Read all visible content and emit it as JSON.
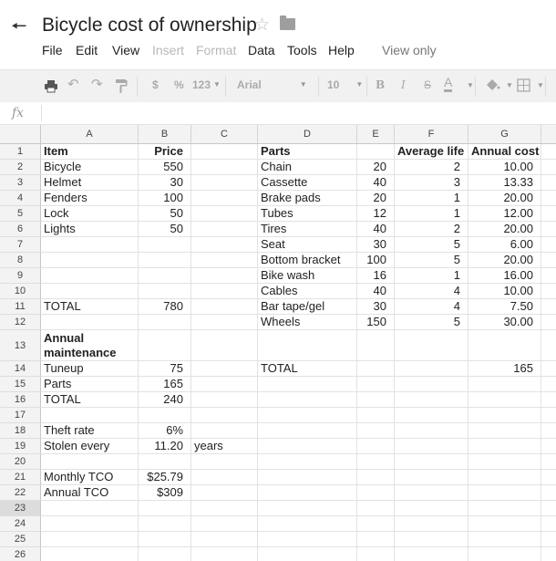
{
  "title": "Bicycle cost of ownership",
  "menu": [
    {
      "label": "File",
      "disabled": false
    },
    {
      "label": "Edit",
      "disabled": false
    },
    {
      "label": "View",
      "disabled": false
    },
    {
      "label": "Insert",
      "disabled": true
    },
    {
      "label": "Format",
      "disabled": true
    },
    {
      "label": "Data",
      "disabled": false
    },
    {
      "label": "Tools",
      "disabled": false
    },
    {
      "label": "Help",
      "disabled": false
    }
  ],
  "view_only_label": "View only",
  "toolbar": {
    "currency": "$",
    "percent": "%",
    "number_format": "123",
    "font": "Arial",
    "font_size": "10",
    "bold": "B",
    "italic": "I",
    "strike": "S",
    "text_color": "A"
  },
  "formula_bar": {
    "fx": "fx",
    "value": ""
  },
  "columns": [
    "A",
    "B",
    "C",
    "D",
    "E",
    "F",
    "G"
  ],
  "selected_row": 23,
  "rows": [
    {
      "n": 1,
      "cells": {
        "A": "Item",
        "B": "Price",
        "D": "Parts",
        "F": "Average life",
        "G": "Annual cost"
      }
    },
    {
      "n": 2,
      "cells": {
        "A": "Bicycle",
        "B": "550",
        "D": "Chain",
        "E": "20",
        "F": "2",
        "G": "10.00"
      }
    },
    {
      "n": 3,
      "cells": {
        "A": "Helmet",
        "B": "30",
        "D": "Cassette",
        "E": "40",
        "F": "3",
        "G": "13.33"
      }
    },
    {
      "n": 4,
      "cells": {
        "A": "Fenders",
        "B": "100",
        "D": "Brake pads",
        "E": "20",
        "F": "1",
        "G": "20.00"
      }
    },
    {
      "n": 5,
      "cells": {
        "A": "Lock",
        "B": "50",
        "D": "Tubes",
        "E": "12",
        "F": "1",
        "G": "12.00"
      }
    },
    {
      "n": 6,
      "cells": {
        "A": "Lights",
        "B": "50",
        "D": "Tires",
        "E": "40",
        "F": "2",
        "G": "20.00"
      }
    },
    {
      "n": 7,
      "cells": {
        "D": "Seat",
        "E": "30",
        "F": "5",
        "G": "6.00"
      }
    },
    {
      "n": 8,
      "cells": {
        "D": "Bottom bracket",
        "E": "100",
        "F": "5",
        "G": "20.00"
      }
    },
    {
      "n": 9,
      "cells": {
        "D": "Bike wash",
        "E": "16",
        "F": "1",
        "G": "16.00"
      }
    },
    {
      "n": 10,
      "cells": {
        "D": "Cables",
        "E": "40",
        "F": "4",
        "G": "10.00"
      }
    },
    {
      "n": 11,
      "cells": {
        "A": "TOTAL",
        "B": "780",
        "D": "Bar tape/gel",
        "E": "30",
        "F": "4",
        "G": "7.50"
      }
    },
    {
      "n": 12,
      "cells": {
        "D": "Wheels",
        "E": "150",
        "F": "5",
        "G": "30.00"
      }
    },
    {
      "n": 13,
      "cells": {
        "A": "Annual maintenance"
      }
    },
    {
      "n": 14,
      "cells": {
        "A": "Tuneup",
        "B": "75",
        "D": "TOTAL",
        "G": "165"
      }
    },
    {
      "n": 15,
      "cells": {
        "A": "Parts",
        "B": "165"
      }
    },
    {
      "n": 16,
      "cells": {
        "A": "TOTAL",
        "B": "240"
      }
    },
    {
      "n": 17,
      "cells": {}
    },
    {
      "n": 18,
      "cells": {
        "A": "Theft rate",
        "B": "6%"
      }
    },
    {
      "n": 19,
      "cells": {
        "A": "Stolen every",
        "B": "11.20",
        "C": "years"
      }
    },
    {
      "n": 20,
      "cells": {}
    },
    {
      "n": 21,
      "cells": {
        "A": "Monthly TCO",
        "B": "$25.79"
      }
    },
    {
      "n": 22,
      "cells": {
        "A": "Annual TCO",
        "B": "$309"
      }
    },
    {
      "n": 23,
      "cells": {}
    },
    {
      "n": 24,
      "cells": {}
    },
    {
      "n": 25,
      "cells": {}
    },
    {
      "n": 26,
      "cells": {}
    }
  ]
}
